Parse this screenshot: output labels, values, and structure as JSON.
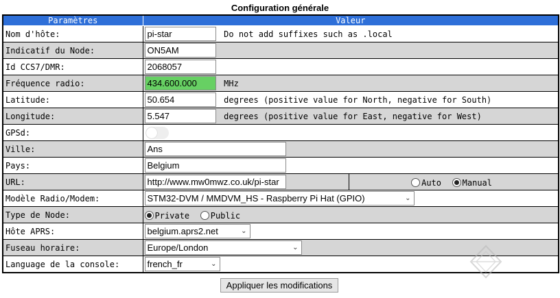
{
  "page_title": "Configuration générale",
  "table": {
    "header_params": "Paramètres",
    "header_value": "Valeur"
  },
  "fields": {
    "hostname": {
      "label": "Nom d'hôte:",
      "value": "pi-star",
      "hint": "Do not add suffixes such as .local"
    },
    "callsign": {
      "label": "Indicatif du Node:",
      "value": "ON5AM"
    },
    "ccs7": {
      "label": "Id CCS7/DMR:",
      "value": "2068057"
    },
    "frequency": {
      "label": "Fréquence radio:",
      "value": "434.600.000",
      "unit": "MHz",
      "highlight_color": "#67d063"
    },
    "latitude": {
      "label": "Latitude:",
      "value": "50.654",
      "hint": "degrees (positive value for North, negative for South)"
    },
    "longitude": {
      "label": "Longitude:",
      "value": "5.547",
      "hint": "degrees (positive value for East, negative for West)"
    },
    "gpsd": {
      "label": "GPSd:",
      "enabled": false
    },
    "city": {
      "label": "Ville:",
      "value": "Ans"
    },
    "country": {
      "label": "Pays:",
      "value": "Belgium"
    },
    "url": {
      "label": "URL:",
      "value": "http://www.mw0mwz.co.uk/pi-star",
      "option_auto": "Auto",
      "option_manual": "Manual",
      "selected": "Manual"
    },
    "modem": {
      "label": "Modèle Radio/Modem:",
      "value": "STM32-DVM / MMDVM_HS - Raspberry Pi Hat (GPIO)"
    },
    "node_type": {
      "label": "Type de Node:",
      "option_private": "Private",
      "option_public": "Public",
      "selected": "Private"
    },
    "aprs_host": {
      "label": "Hôte APRS:",
      "value": "belgium.aprs2.net"
    },
    "timezone": {
      "label": "Fuseau horaire:",
      "value": "Europe/London"
    },
    "language": {
      "label": "Language de la console:",
      "value": "french_fr"
    }
  },
  "apply_label": "Appliquer les modifications",
  "colors": {
    "header_bg": "#2e6fd8",
    "row_gray": "#d6d6d6"
  }
}
